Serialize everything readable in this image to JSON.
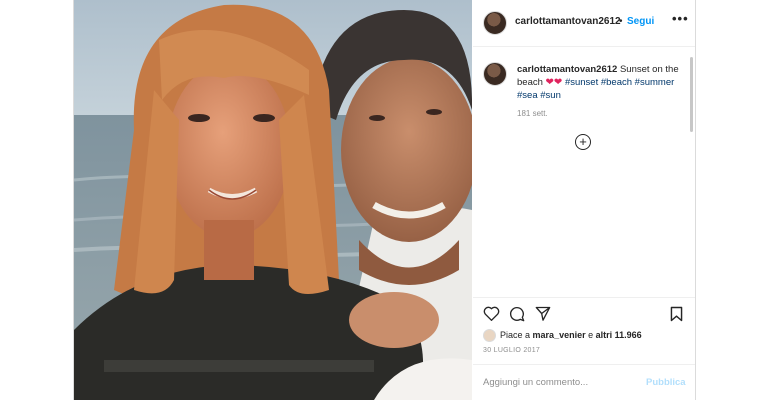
{
  "post": {
    "username": "carlottamantovan2612",
    "follow_separator": "•",
    "follow_label": "Segui",
    "more_label": "•••",
    "caption": {
      "username": "carlottamantovan2612",
      "text": "Sunset on the beach",
      "emoji": "❤❤",
      "hashtags": [
        "#sunset",
        "#beach",
        "#summer",
        "#sea",
        "#sun"
      ]
    },
    "time_ago": "181 sett.",
    "load_more_label": "+",
    "likes_prefix": "Piace a",
    "likes_user": "mara_venier",
    "likes_mid": "e",
    "likes_others": "altri 11.966",
    "date": "30 LUGLIO 2017",
    "comment_placeholder": "Aggiungi un commento...",
    "publish_label": "Pubblica"
  },
  "colors": {
    "link": "#0095f6",
    "hashtag": "#00376b",
    "heart": "#e0245e",
    "publish_disabled": "#b2dffc"
  },
  "icons": [
    "heart-icon",
    "comment-icon",
    "share-icon",
    "save-icon",
    "more-icon",
    "add-icon"
  ]
}
